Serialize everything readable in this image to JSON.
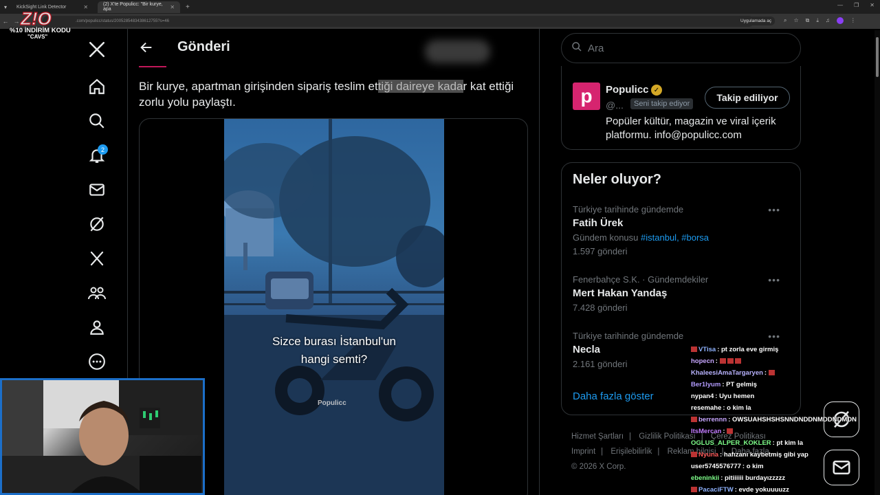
{
  "browser": {
    "tabs": [
      {
        "label": "KickSight Link Detector",
        "active": false
      },
      {
        "label": "(2) X'te Populicc: \"Bir kurye, apa",
        "active": true
      }
    ],
    "url": ".com/populicc/status/2005285483438612755?s=46",
    "open_in_app": "Uygulamada aç"
  },
  "promo": {
    "logo": "Z!O",
    "line1": "%10 İNDİRİM KODU",
    "line2": "\"CAVS\""
  },
  "nav": {
    "notification_badge": "2",
    "icons": [
      "x-logo-icon",
      "home-icon",
      "search-icon",
      "bell-icon",
      "mail-icon",
      "grok-icon",
      "x-premium-icon",
      "communities-icon",
      "profile-icon",
      "more-icon"
    ]
  },
  "post": {
    "header_title": "Gönderi",
    "text_pre": "Bir kurye, apartman girişinden sipariş teslim et",
    "text_hl": "tiği daireye kada",
    "text_post": "r kat ettiği zorlu yolu paylaştı.",
    "video": {
      "caption_line1": "Sizce burası İstanbul'un",
      "caption_line2": "hangi semti?",
      "watermark": "Populicc"
    }
  },
  "sidebar": {
    "search_placeholder": "Ara",
    "profile": {
      "avatar_letter": "p",
      "name": "Populicc",
      "handle": "@...",
      "follows_you": "Seni takip ediyor",
      "follow_button": "Takip ediliyor",
      "bio": "Popüler kültür, magazin ve viral içerik platformu. info@populicc.com"
    },
    "trends_title": "Neler oluyor?",
    "trends": [
      {
        "meta": "Türkiye tarihinde gündemde",
        "name": "Fatih Ürek",
        "sub": "Gündem konusu",
        "tags": "#istanbul, #borsa",
        "count": "1.597 gönderi"
      },
      {
        "meta": "Fenerbahçe S.K. · Gündemdekiler",
        "name": "Mert Hakan Yandaş",
        "count": "7.428 gönderi"
      },
      {
        "meta": "Türkiye tarihinde gündemde",
        "name": "Necla",
        "count": "2.161 gönderi"
      }
    ],
    "show_more": "Daha fazla göster",
    "footer": {
      "links": [
        "Hizmet Şartları",
        "Gizlilik Politikası",
        "Çerez Politikası",
        "Imprint",
        "Erişilebilirlik",
        "Reklam bilgisi",
        "Daha fazla"
      ],
      "copyright": "© 2026 X Corp."
    }
  },
  "chat": [
    {
      "user": "VTisa",
      "color": "#8fb3ff",
      "msg": ": pt zorla eve girmiş"
    },
    {
      "user": "hopecn",
      "color": "#c7a6ff",
      "msg": ":"
    },
    {
      "user": "KhaleesiAmaTargaryen",
      "color": "#b9b3ff",
      "msg": ":"
    },
    {
      "user": "Ber1lyum",
      "color": "#b39cff",
      "msg": ": PT gelmiş"
    },
    {
      "user": "nypan4",
      "color": "#ffffff",
      "msg": ": Uyu hemen"
    },
    {
      "user": "resemahe",
      "color": "#ffffff",
      "msg": ": o kim la"
    },
    {
      "user": "berrennn",
      "color": "#c7a6ff",
      "msg": ": OWSUAHSHSHSNNDNDDNMDDNDMDN"
    },
    {
      "user": "ItsMercan",
      "color": "#c27bff",
      "msg": ":"
    },
    {
      "user": "OGLUS_ALPER_KOKLER",
      "color": "#7fff8a",
      "msg": ": pt kim la"
    },
    {
      "user": "Nyuna",
      "color": "#ff5a5a",
      "msg": ": hafızanı kaybetmiş gibi yap"
    },
    {
      "user": "user5745576777",
      "color": "#ffffff",
      "msg": ": o kim"
    },
    {
      "user": "ebeninkii",
      "color": "#7fff8a",
      "msg": ": pitiiiiii burdayızzzzz"
    },
    {
      "user": "PacaciFTW",
      "color": "#8fb3ff",
      "msg": ": evde yokuuuuzz"
    }
  ]
}
